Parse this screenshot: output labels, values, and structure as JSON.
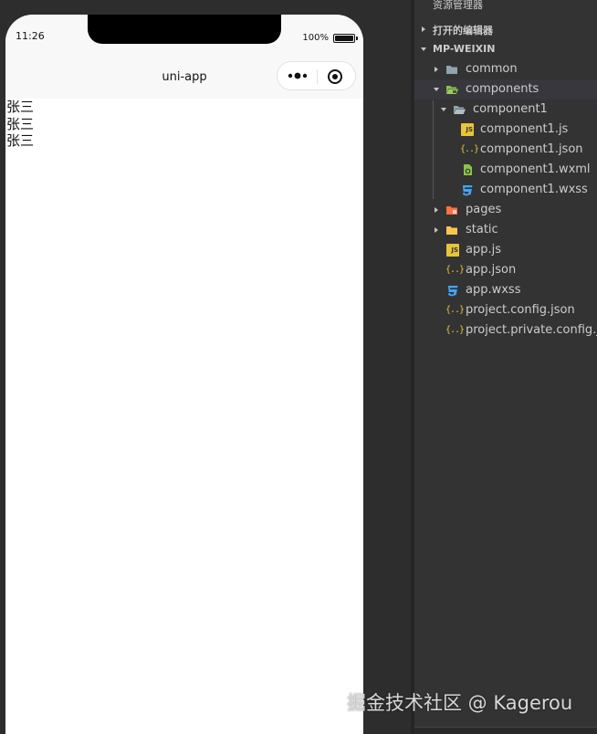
{
  "phone": {
    "status_time": "11:26",
    "battery_text": "100%",
    "nav_title": "uni-app",
    "content_lines": [
      "张三",
      "张三",
      "张三"
    ]
  },
  "explorer": {
    "title": "资源管理器",
    "more": "···",
    "sections": {
      "open_editors": "打开的编辑器",
      "project": "MP-WEIXIN"
    },
    "tree": {
      "common": "common",
      "components": "components",
      "component1": "component1",
      "component1_js": "component1.js",
      "component1_json": "component1.json",
      "component1_wxml": "component1.wxml",
      "component1_wxss": "component1.wxss",
      "pages": "pages",
      "static": "static",
      "app_js": "app.js",
      "app_json": "app.json",
      "app_wxss": "app.wxss",
      "project_config": "project.config.json",
      "project_private_config": "project.private.config.js..."
    }
  },
  "watermark": "掘金技术社区 @ Kagerou",
  "colors": {
    "explorer_bg": "#333333",
    "selected_row": "#37373d",
    "folder_gray": "#90a4ae",
    "folder_green": "#8bc34a",
    "folder_orange": "#ff7043",
    "folder_yellow": "#f9c74f",
    "js_yellow": "#e8c43a",
    "css_blue": "#42a5f5"
  }
}
